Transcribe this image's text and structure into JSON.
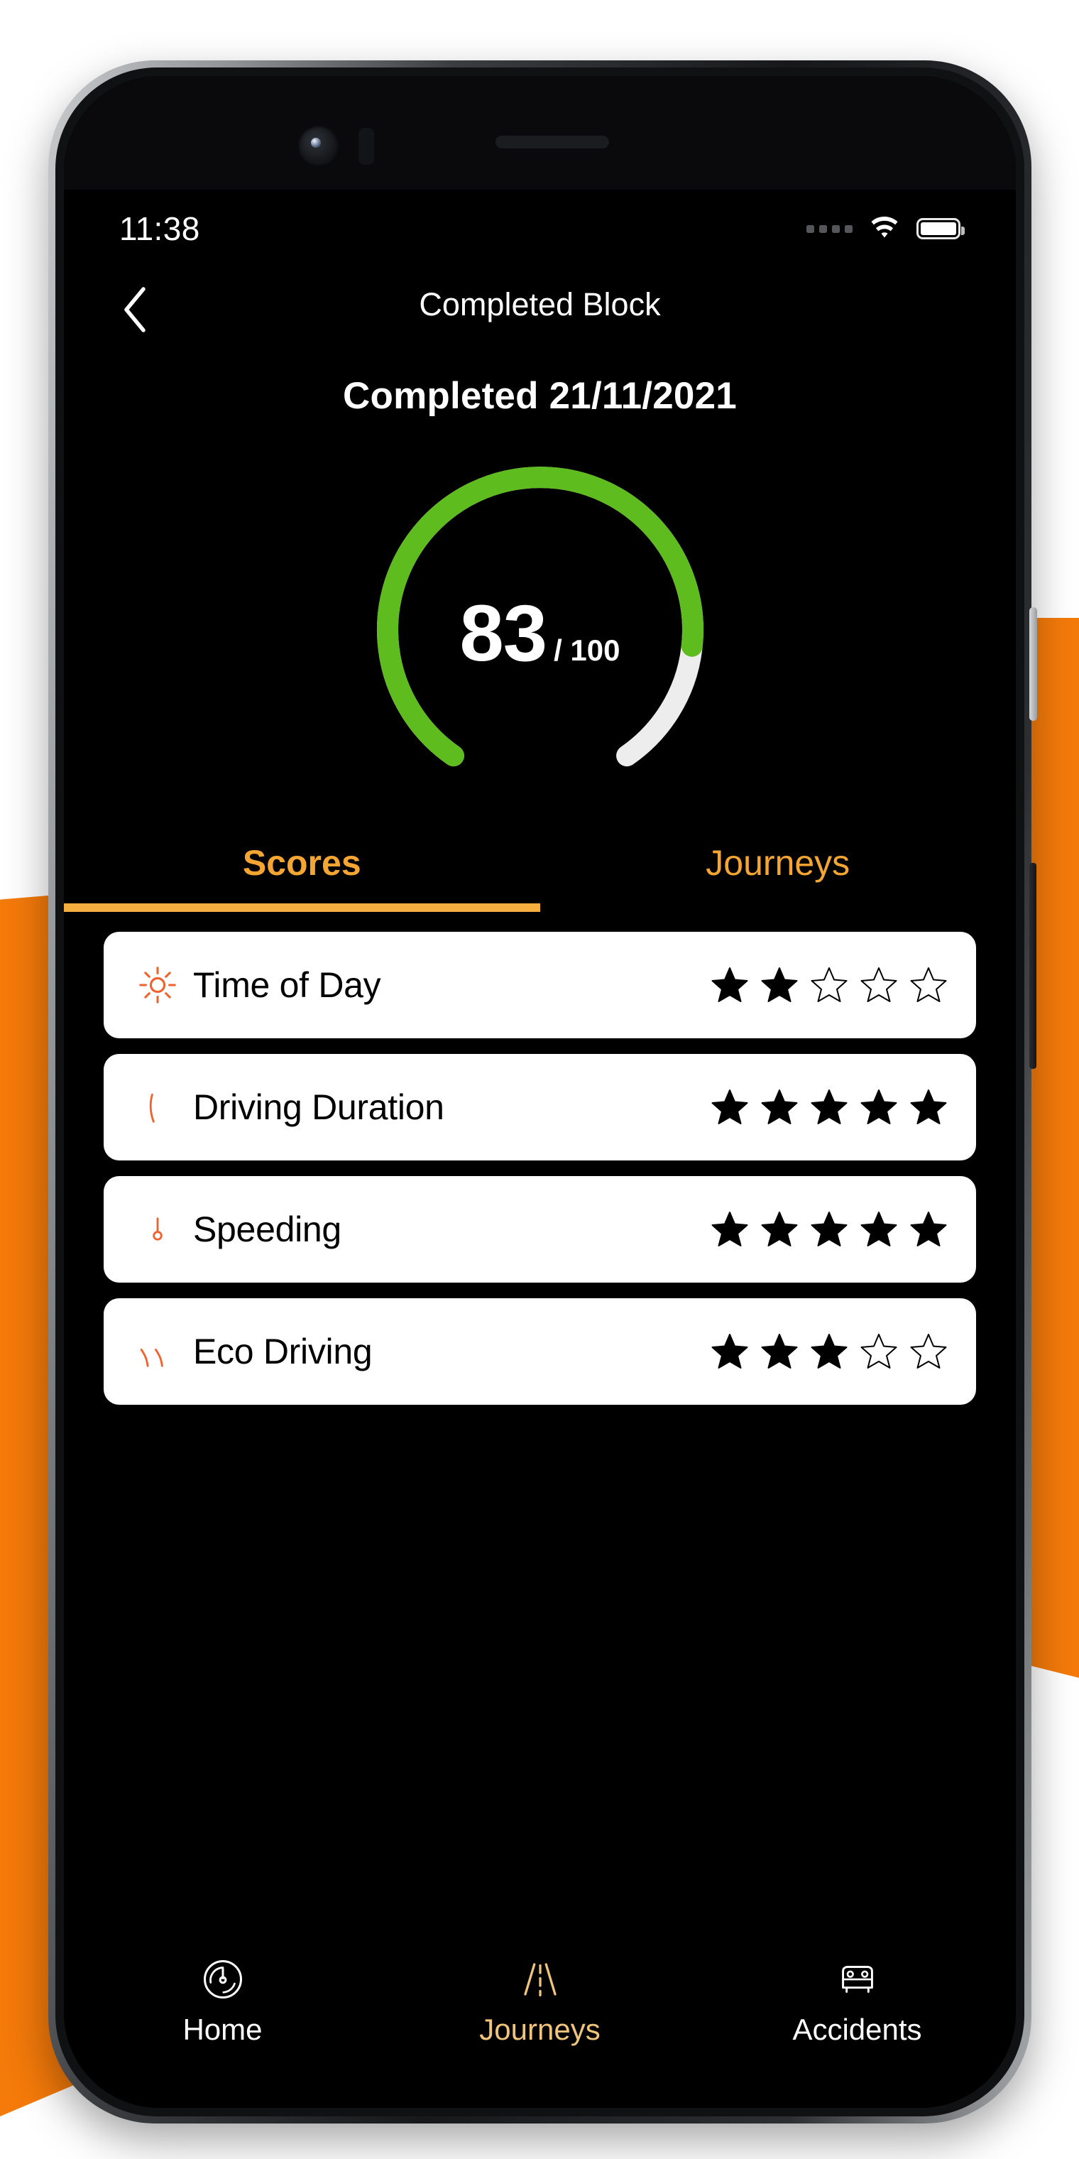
{
  "theme": {
    "accent_orange": "#F5A531",
    "bg_orange": "#F47A0A",
    "gauge_green": "#5FBC1E",
    "gauge_track": "#EDEDED",
    "screen_bg": "#000000",
    "card_bg": "#FFFFFF",
    "icon_orange": "#F2602B"
  },
  "status_bar": {
    "time": "11:38",
    "signal_icon": "signal-dots-icon",
    "wifi_icon": "wifi-icon",
    "battery_icon": "battery-full-icon"
  },
  "navbar": {
    "back_icon": "chevron-left-icon",
    "title": "Completed Block"
  },
  "header": {
    "completed_label": "Completed 21/11/2021"
  },
  "gauge": {
    "score": "83",
    "max_label": "/ 100",
    "value": 83,
    "max": 100,
    "filled_color": "#5FBC1E",
    "track_color": "#EDEDED"
  },
  "tabs": [
    {
      "label": "Scores",
      "active": true
    },
    {
      "label": "Journeys",
      "active": false
    }
  ],
  "scores": [
    {
      "label": "Time of Day",
      "icon": "sun-icon",
      "stars": 2,
      "max_stars": 5
    },
    {
      "label": "Driving Duration",
      "icon": "stopwatch-icon",
      "stars": 5,
      "max_stars": 5
    },
    {
      "label": "Speeding",
      "icon": "speedometer-icon",
      "stars": 5,
      "max_stars": 5
    },
    {
      "label": "Eco Driving",
      "icon": "eco-leaf-icon",
      "stars": 3,
      "max_stars": 5
    }
  ],
  "bottom_nav": [
    {
      "label": "Home",
      "icon": "speedometer-gauge-icon",
      "active": false
    },
    {
      "label": "Journeys",
      "icon": "road-icon",
      "active": true
    },
    {
      "label": "Accidents",
      "icon": "car-icon",
      "active": false
    }
  ]
}
